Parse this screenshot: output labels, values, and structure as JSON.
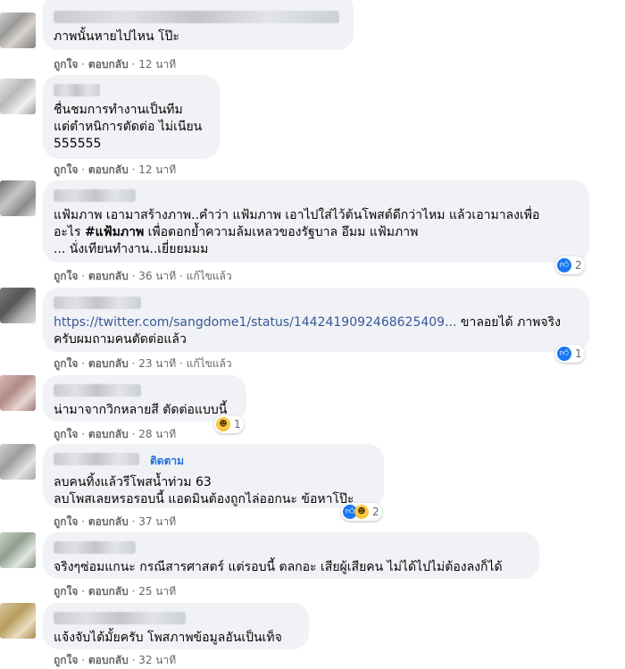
{
  "comments": [
    {
      "text": "ภาพนั้นหายไปไหน โป๊ะ",
      "actions": {
        "like": "ถูกใจ",
        "reply": "ตอบกลับ",
        "time": "12 นาที"
      }
    },
    {
      "text": "ชื่นชมการทำงานเป็นทีม\nแต่ตำหนิการตัดต่อ ไม่เนียน\n555555",
      "actions": {
        "like": "ถูกใจ",
        "reply": "ตอบกลับ",
        "time": "12 นาที"
      }
    },
    {
      "text_1": "แฟ้มภาพ เอามาสร้างภาพ..คำว่า แฟ้มภาพ เอาไปใส่ไว้ต้นโพสต์ดีกว่าไหม แล้วเอามาลงเพื่อ",
      "text_2a": "อะไร ",
      "text_2b": "#แฟ้มภาพ",
      "text_2c": " เพื่อตอกย้ำความล้มเหลวของรัฐบาล อึมม แฟ้มภาพ",
      "text_3": "... นั่งเทียนทำงาน..เยี่ยยมมม",
      "reaction_count": "2",
      "actions": {
        "like": "ถูกใจ",
        "reply": "ตอบกลับ",
        "time": "36 นาที",
        "edited": "แก้ไขแล้ว"
      }
    },
    {
      "link": "https://twitter.com/sangdome1/status/1442419092468625409...",
      "text_after_link": " ขาลอยได้ ภาพจริง",
      "text_2": "ครับผมถามคนตัดต่อแล้ว",
      "reaction_count": "1",
      "actions": {
        "like": "ถูกใจ",
        "reply": "ตอบกลับ",
        "time": "23 นาที",
        "edited": "แก้ไขแล้ว"
      }
    },
    {
      "text": "น่ามาจากวิกหลายสี ตัดต่อแบบนี้",
      "reaction_count": "1",
      "actions": {
        "like": "ถูกใจ",
        "reply": "ตอบกลับ",
        "time": "28 นาที"
      }
    },
    {
      "follow": "ติดตาม",
      "text": "ลบคนทิ้งแล้วรีโพสน้ำท่วม 63\nลบโพสเลยหรอรอบนี้ แอดมินต้องถูกไล่ออกนะ ข้อหาโป๊ะ",
      "reaction_count": "2",
      "actions": {
        "like": "ถูกใจ",
        "reply": "ตอบกลับ",
        "time": "37 นาที"
      }
    },
    {
      "text": "จริงๆซ่อมแกนะ กรณีสารศาสตร์ แต่รอบนี้ ตลกอะ เสียผู้เสียคน ไม่ได้ไปไม่ต้องลงก็ได้",
      "actions": {
        "like": "ถูกใจ",
        "reply": "ตอบกลับ",
        "time": "25 นาที"
      }
    },
    {
      "text": "แจ้งจับได้มั้ยครับ โพสภาพข้อมูลอันเป็นเท็จ",
      "actions": {
        "like": "ถูกใจ",
        "reply": "ตอบกลับ",
        "time": "32 นาที"
      }
    }
  ],
  "separator": " · ",
  "icons": {
    "like": "thumbs-up-icon",
    "haha": "haha-face-icon"
  },
  "colors": {
    "bubble": "#f0f2f5",
    "link": "#385898",
    "meta": "#65676b",
    "like_blue": "#1877f2"
  }
}
